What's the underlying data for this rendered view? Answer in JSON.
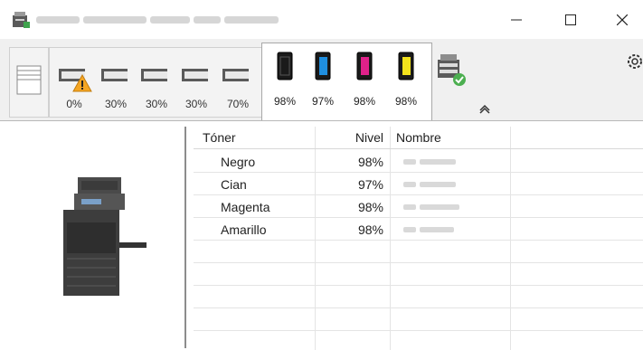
{
  "window": {
    "minimize_icon": "minimize-icon",
    "maximize_icon": "maximize-icon",
    "close_icon": "close-icon"
  },
  "toolbar": {
    "paper_trays": [
      {
        "name": "tray-1",
        "level": "0%",
        "warning": true
      },
      {
        "name": "tray-2",
        "level": "30%",
        "warning": false
      },
      {
        "name": "tray-3",
        "level": "30%",
        "warning": false
      },
      {
        "name": "tray-4",
        "level": "30%",
        "warning": false
      },
      {
        "name": "tray-5",
        "level": "70%",
        "warning": false
      }
    ],
    "toners": [
      {
        "color_name": "black",
        "color": "#1a1a1a",
        "level": "98%"
      },
      {
        "color_name": "cyan",
        "color": "#1f8fe0",
        "level": "97%"
      },
      {
        "color_name": "magenta",
        "color": "#e0218a",
        "level": "98%"
      },
      {
        "color_name": "yellow",
        "color": "#f2e21c",
        "level": "98%"
      }
    ],
    "settings_icon": "gear-icon",
    "collapse_icon": "chevron-up-icon",
    "device_status_icon": "device-check-icon"
  },
  "table": {
    "headers": [
      "Tóner",
      "Nivel",
      "Nombre"
    ],
    "rows": [
      {
        "toner": "Negro",
        "nivel": "98%"
      },
      {
        "toner": "Cian",
        "nivel": "97%"
      },
      {
        "toner": "Magenta",
        "nivel": "98%"
      },
      {
        "toner": "Amarillo",
        "nivel": "98%"
      }
    ]
  }
}
